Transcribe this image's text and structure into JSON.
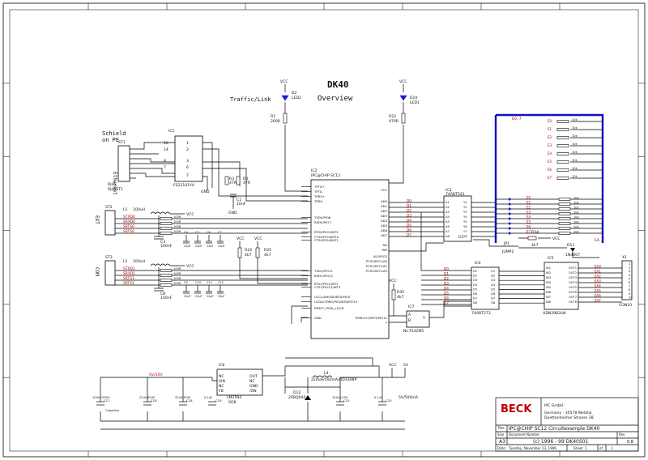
{
  "title": {
    "main": "DK40",
    "sub": "Overview",
    "traffic": "Traffic/Link"
  },
  "shield_note": [
    "Schield",
    "on PE"
  ],
  "ethernet_label": "Ethernet",
  "ext_label": "EXT",
  "com_label": "COM",
  "vcc": "VCC",
  "gnd": "GND",
  "v5": "5V",
  "v24": "5V/24V",
  "power_note": "5V/500mA",
  "st1": {
    "ref": "ST1",
    "part": "RJ45",
    "pn": "RJ45ST1"
  },
  "ic1": {
    "ref": "IC1",
    "part": "FS22101Y4",
    "pins_l": [
      "16",
      "14",
      "11",
      "9"
    ],
    "pins_r": [
      "1",
      "2",
      "3",
      "6",
      "7",
      "8"
    ],
    "pins_lo": [
      "8",
      "7",
      "6",
      "3"
    ]
  },
  "ic2": {
    "ref": "IC2",
    "part": "IPC@CHIP SC12",
    "left": [
      "TPTX+",
      "TPTX-",
      "TPRX+",
      "TPRX-",
      "TXD0/PIO6",
      "RXD0/PIO7",
      "RTS0/PIO5/INT2",
      "CTS0/PIO4/INT4",
      "CTS0/PIO4/INT1",
      "TXD1/PIO11",
      "RXD1/PIO12",
      "RTS1/PIO1/INT2",
      "CTS1/PIO13/INT3",
      "UCCL/AMOID/INTA/PIO0",
      "UCDA/TMRO/PIO/INTA/PIO13",
      "RESET_PFAIL_LILED",
      "GND"
    ],
    "right": [
      "VCC",
      "AD0",
      "AD1",
      "AD2",
      "AD3",
      "AD4",
      "AD5",
      "AD6",
      "AD7",
      "RD",
      "WR",
      "ALE/PIO2",
      "PCS0/PIO1/A0",
      "PCS1/PIO1/A1",
      "PCS2/INT1/A2",
      "TMRIOUT/INT3/PIO12",
      "7"
    ]
  },
  "ic3": {
    "ref": "IC3",
    "part": "74ABT541",
    "a": [
      "A1",
      "A2",
      "A3",
      "A4",
      "A5",
      "A6",
      "A7",
      "A8"
    ],
    "y": [
      "Y1",
      "Y2",
      "Y3",
      "Y4",
      "Y5",
      "Y6",
      "Y7",
      "Y8"
    ],
    "g": [
      "G1",
      "G2"
    ]
  },
  "ic4": {
    "ref": "IC4",
    "part": "74ABT273",
    "d": [
      "D1",
      "D2",
      "D3",
      "D4",
      "D5",
      "D6",
      "D7",
      "D8"
    ],
    "q": [
      "Q1",
      "Q2",
      "Q3",
      "Q4",
      "Q5",
      "Q6",
      "Q7",
      "Q8"
    ],
    "ctl": [
      "CLK",
      "CLR"
    ]
  },
  "ic5": {
    "ref": "IC5",
    "part": "UDN2982LW",
    "in": [
      "IN1",
      "IN2",
      "IN3",
      "IN4",
      "IN5",
      "IN6",
      "IN7",
      "IN8"
    ],
    "out": [
      "OUT1",
      "OUT2",
      "OUT3",
      "OUT4",
      "OUT5",
      "OUT6",
      "OUT7",
      "OUT8"
    ],
    "misc": [
      "VS",
      "GND"
    ]
  },
  "ic6": {
    "ref": "IC6",
    "part": "LM2594",
    "pn": "SO8",
    "pins": [
      "NC",
      "VIN",
      "NC",
      "FB",
      "OUT",
      "NC",
      "GND",
      "/ON"
    ]
  },
  "ic7": {
    "ref": "IC7",
    "part": "NC7S32M5",
    "pins": [
      "A",
      "B",
      "Y"
    ]
  },
  "x1": {
    "ref": "X1",
    "part": "CON10"
  },
  "leds": [
    {
      "ref": "D2",
      "val": "LED2"
    },
    {
      "ref": "D10",
      "val": "LED1"
    },
    {
      "ref": "D11",
      "val": "1N4007"
    }
  ],
  "resistors": [
    {
      "ref": "R1",
      "val": "200R"
    },
    {
      "ref": "R22",
      "val": "470R"
    },
    {
      "ref": "R3",
      "val": "47R"
    },
    {
      "ref": "R4",
      "val": "47R"
    },
    {
      "ref": "R24",
      "val": "4k7"
    },
    {
      "ref": "R25",
      "val": "4k7"
    },
    {
      "ref": "R35",
      "val": "4k7"
    },
    {
      "ref": "R34",
      "val": "4k7"
    }
  ],
  "rnet_val": "100R",
  "rk_val": "10k",
  "caps": [
    {
      "ref": "C1",
      "val": "10nF"
    },
    {
      "ref": "C3",
      "val": "100nF"
    },
    {
      "ref": "C4",
      "val": "22pF"
    },
    {
      "ref": "C5",
      "val": "22pF"
    },
    {
      "ref": "C6",
      "val": "22pF"
    },
    {
      "ref": "C7",
      "val": "22pF"
    },
    {
      "ref": "C8",
      "val": "100nF"
    },
    {
      "ref": "C9",
      "val": "22pF"
    },
    {
      "ref": "C10",
      "val": "22pF"
    },
    {
      "ref": "C11",
      "val": "22pF"
    },
    {
      "ref": "C12",
      "val": "22pF"
    }
  ],
  "inductors": [
    {
      "ref": "L1",
      "val": "100uH"
    },
    {
      "ref": "L2",
      "val": "100uH"
    },
    {
      "ref": "L4",
      "val": "220uH/500mA/OD3308P"
    }
  ],
  "power_caps": [
    {
      "ref": "C17",
      "val": "100nF/250V",
      "sub": "Capacitor"
    },
    {
      "ref": "C18",
      "val": "22uF/35VE"
    },
    {
      "ref": "C18b",
      "val": "22uF/35VE"
    },
    {
      "ref": "C19",
      "val": "0.1uF"
    },
    {
      "ref": "C15",
      "val": "100uF/15V"
    },
    {
      "ref": "C20",
      "val": "0.1uF"
    }
  ],
  "diode": {
    "ref": "D12",
    "val": "20BQ040"
  },
  "nets": {
    "ext": [
      "STXD0",
      "SRXD0",
      "SRTS0",
      "SRTS0"
    ],
    "com": [
      "STXD1",
      "SRXD1",
      "SRTS1",
      "SRTS1"
    ],
    "bus": "E0..7",
    "d": [
      "D0",
      "D1",
      "D2",
      "D3",
      "D4",
      "D5",
      "D6",
      "D7"
    ],
    "ea": "EA..7",
    "e": [
      "E0",
      "E1",
      "E2",
      "E3",
      "E4",
      "E5",
      "E6",
      "E7"
    ],
    "jp": "JP1",
    "jp_val": "JUMP2"
  },
  "titleblock": {
    "company": "IPC GmbH",
    "addr1": "Germany - 35578 Wetzlar",
    "addr2": "Duettenheimer Strasse 38",
    "logo": "BECK",
    "title_lbl": "Title",
    "title": "IPC@CHIP SC12 Circuitexample DK40",
    "size_lbl": "Size",
    "size": "A3",
    "docnum_lbl": "Document Number",
    "docnum": "(c) 1996 - 99 DK40S01",
    "rev_lbl": "Rev",
    "rev": "0.8",
    "date_lbl": "Date:",
    "date": "Tuesday, November 23, 1999",
    "sheet_lbl": "Sheet",
    "sheet": "1",
    "of_lbl": "of",
    "of": "1"
  },
  "border_cols": [
    "1",
    "2",
    "3",
    "4",
    "5",
    "6",
    "7",
    "8"
  ],
  "border_rows": [
    "A",
    "B",
    "C",
    "D",
    "E",
    "F"
  ],
  "colors": {
    "wire": "#000000",
    "net": "#b00000",
    "bus": "#1010c0",
    "led": "#1a1ad0"
  }
}
